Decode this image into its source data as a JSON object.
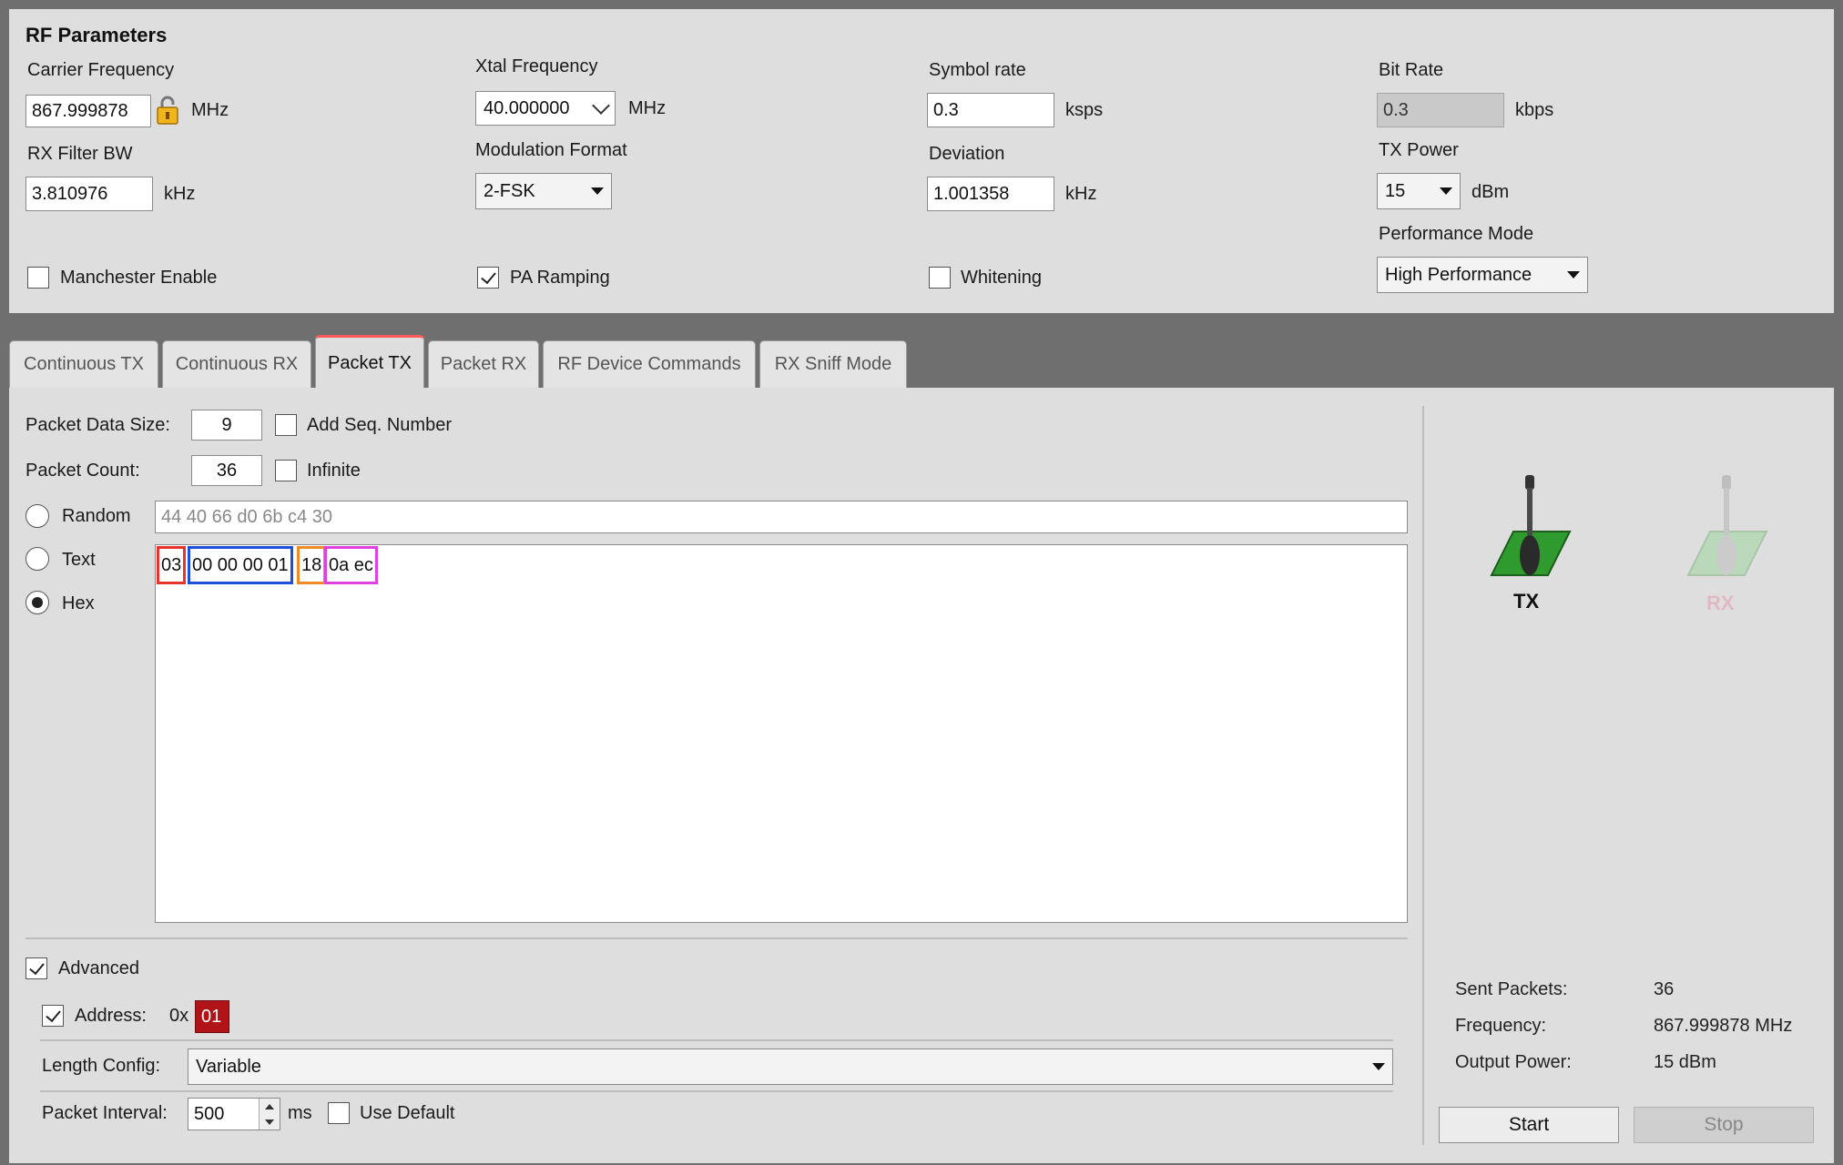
{
  "rf": {
    "title": "RF Parameters",
    "carrier_frequency": {
      "label": "Carrier Frequency",
      "value": "867.999878",
      "unit": "MHz"
    },
    "xtal_frequency": {
      "label": "Xtal Frequency",
      "value": "40.000000",
      "unit": "MHz"
    },
    "symbol_rate": {
      "label": "Symbol rate",
      "value": "0.3",
      "unit": "ksps"
    },
    "bit_rate": {
      "label": "Bit Rate",
      "value": "0.3",
      "unit": "kbps"
    },
    "rx_filter_bw": {
      "label": "RX Filter BW",
      "value": "3.810976",
      "unit": "kHz"
    },
    "modulation_format": {
      "label": "Modulation Format",
      "value": "2-FSK"
    },
    "deviation": {
      "label": "Deviation",
      "value": "1.001358",
      "unit": "kHz"
    },
    "tx_power": {
      "label": "TX Power",
      "value": "15",
      "unit": "dBm"
    },
    "performance_mode": {
      "label": "Performance Mode",
      "value": "High Performance"
    },
    "manchester": {
      "label": "Manchester Enable",
      "checked": false
    },
    "pa_ramping": {
      "label": "PA Ramping",
      "checked": true
    },
    "whitening": {
      "label": "Whitening",
      "checked": false
    }
  },
  "tabs": [
    {
      "label": "Continuous TX",
      "active": false
    },
    {
      "label": "Continuous RX",
      "active": false
    },
    {
      "label": "Packet TX",
      "active": true
    },
    {
      "label": "Packet RX",
      "active": false
    },
    {
      "label": "RF Device Commands",
      "active": false
    },
    {
      "label": "RX Sniff Mode",
      "active": false
    }
  ],
  "packet": {
    "data_size_label": "Packet Data Size:",
    "data_size": "9",
    "add_seq_label": "Add Seq. Number",
    "count_label": "Packet Count:",
    "count": "36",
    "infinite_label": "Infinite",
    "random_label": "Random",
    "random_value": "44 40 66 d0 6b c4 30",
    "text_label": "Text",
    "hex_label": "Hex",
    "hex_segments": [
      {
        "text": "03",
        "color": "#e8322c"
      },
      {
        "text": "00 00 00 01",
        "color": "#1f4fd8"
      },
      {
        "text": "18",
        "color": "#f08a24"
      },
      {
        "text": "0a ec",
        "color": "#e040e0"
      }
    ]
  },
  "advanced": {
    "label": "Advanced",
    "checked": true,
    "address_label": "Address:",
    "address_prefix": "0x",
    "address_value": "01",
    "address_color": "#b01418",
    "length_config_label": "Length Config:",
    "length_config_value": "Variable",
    "interval_label": "Packet Interval:",
    "interval_value": "500",
    "interval_unit": "ms",
    "use_default_label": "Use Default"
  },
  "status": {
    "tx_label": "TX",
    "rx_label": "RX",
    "sent_packets_label": "Sent Packets:",
    "sent_packets": "36",
    "frequency_label": "Frequency:",
    "frequency": "867.999878 MHz",
    "output_power_label": "Output Power:",
    "output_power": "15 dBm",
    "start_label": "Start",
    "stop_label": "Stop"
  }
}
